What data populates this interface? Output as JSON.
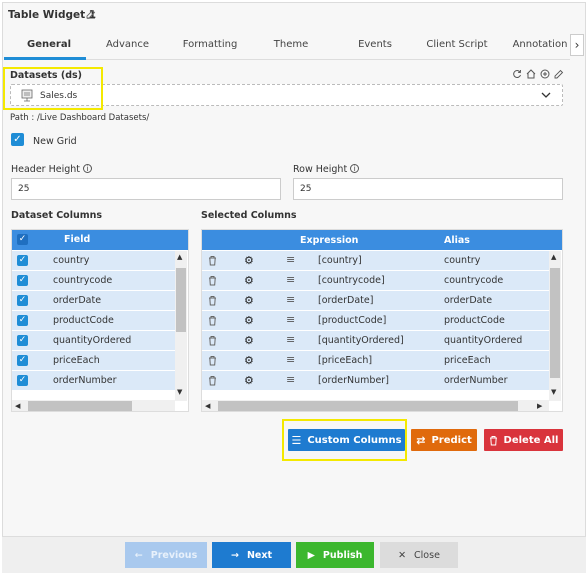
{
  "widget": {
    "title": "Table Widget 1"
  },
  "tabs": [
    "General",
    "Advance",
    "Formatting",
    "Theme",
    "Events",
    "Client Script",
    "Annotation"
  ],
  "dataset": {
    "label": "Datasets (ds)",
    "value": "Sales.ds",
    "path": "Path : /Live Dashboard Datasets/"
  },
  "new_grid": {
    "label": "New Grid",
    "checked": true
  },
  "header_height": {
    "label": "Header Height",
    "value": "25"
  },
  "row_height": {
    "label": "Row Height",
    "value": "25"
  },
  "dataset_columns": {
    "label": "Dataset Columns",
    "header": "Field",
    "rows": [
      "country",
      "countrycode",
      "orderDate",
      "productCode",
      "quantityOrdered",
      "priceEach",
      "orderNumber"
    ]
  },
  "selected_columns": {
    "label": "Selected Columns",
    "headers": {
      "expression": "Expression",
      "alias": "Alias"
    },
    "rows": [
      {
        "expression": "[country]",
        "alias": "country"
      },
      {
        "expression": "[countrycode]",
        "alias": "countrycode"
      },
      {
        "expression": "[orderDate]",
        "alias": "orderDate"
      },
      {
        "expression": "[productCode]",
        "alias": "productCode"
      },
      {
        "expression": "[quantityOrdered]",
        "alias": "quantityOrdered"
      },
      {
        "expression": "[priceEach]",
        "alias": "priceEach"
      },
      {
        "expression": "[orderNumber]",
        "alias": "orderNumber"
      }
    ]
  },
  "actions": {
    "custom_columns": "Custom Columns",
    "predict": "Predict",
    "delete_all": "Delete All"
  },
  "footer": {
    "previous": "Previous",
    "next": "Next",
    "publish": "Publish",
    "close": "Close"
  },
  "colors": {
    "accent": "#1f8dd6",
    "header_blue": "#3b8de0",
    "row_blue": "#dbe9f8",
    "custom_btn": "#1e7bd0",
    "predict_btn": "#e06a0c",
    "delete_btn": "#d9343c",
    "publish_btn": "#3cb72e",
    "highlight": "#f4e900"
  }
}
